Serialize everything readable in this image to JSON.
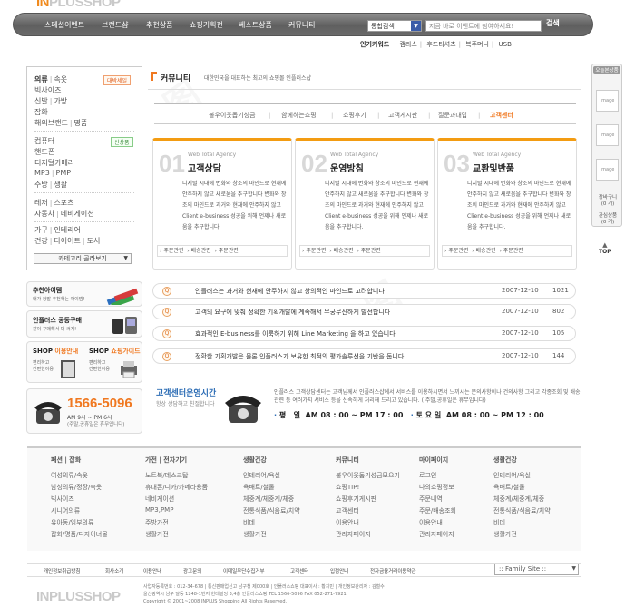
{
  "header": {
    "logo_prefix": "IN",
    "logo_rest": "PLUSSHOP",
    "nav": [
      "스페셜이벤트",
      "브랜드샵",
      "추천상품",
      "쇼핑기획전",
      "베스트상품",
      "커뮤니티"
    ],
    "search_select": "통합검색",
    "search_placeholder": "지금 바로 이벤트에 참여하세요!",
    "search_button": "검색",
    "popular_label": "인기키워드",
    "popular": [
      "캠리스",
      "후드티셔츠",
      "복주머니",
      "USB"
    ]
  },
  "sidebar": {
    "rows": [
      {
        "items": [
          "의류",
          "속옷"
        ],
        "bold": [
          0
        ]
      },
      {
        "items": [
          "빅사이즈"
        ]
      },
      {
        "items": [
          "신발",
          "가방"
        ]
      },
      {
        "items": [
          "잡화"
        ]
      },
      {
        "items": [
          "해외브랜드",
          "명품"
        ]
      },
      {
        "items": [
          "컴퓨터"
        ]
      },
      {
        "items": [
          "핸드폰"
        ]
      },
      {
        "items": [
          "디지털카메라"
        ]
      },
      {
        "items": [
          "MP3",
          "PMP"
        ]
      },
      {
        "items": [
          "주방",
          "생활"
        ]
      },
      {
        "items": [
          "레저",
          "스포츠"
        ]
      },
      {
        "items": [
          "자동차",
          "네비게이션"
        ]
      },
      {
        "items": [
          "가구",
          "인테리어"
        ]
      },
      {
        "items": [
          "건강",
          "다이어트",
          "도서"
        ]
      }
    ],
    "tag1": "대박세일",
    "tag2": "신상품",
    "more": "카테고리 골라보기",
    "banner1_title": "추천아이템",
    "banner1_sub": "내가 정말 추천하는 아이템!",
    "banner2_title": "인플러스 공동구매",
    "banner2_sub": "같이 구매해서 더 써게!",
    "banner3_left_a": "SHOP",
    "banner3_left_b": "이용안내",
    "banner3_left_sub1": "편리하고",
    "banner3_left_sub2": "간편한이용",
    "banner3_right_a": "SHOP",
    "banner3_right_b": "쇼핑가이드",
    "banner3_right_sub1": "편리하고",
    "banner3_right_sub2": "간편한이용",
    "phone": "1566-5096",
    "phone_hours": "AM 9시 ~ PM 6시",
    "phone_note": "(주말,공휴일은 휴무입니다)"
  },
  "main": {
    "title": "커뮤니티",
    "subtitle": "대한민국을 대표하는 최고의 쇼핑몰 인플러스샵",
    "tabs": [
      "불우이웃돕기성금",
      "함께하는쇼핑",
      "쇼핑후기",
      "고객게시판",
      "질문과대답",
      "고객센터"
    ],
    "panels": [
      {
        "num": "01",
        "agency": "Web Total Agency",
        "title": "고객상담",
        "body": "디지털 시대에 변화와 창조의 마인드로 현재에 안주하지 않고 새로움을 추구합니다 변화와 창조의 마인드로 과거와 현재에 안주하지 않고 Client e-business 성공을 위해 언제나 새로움을 추구합니다.",
        "links": [
          "주문관련",
          "배송관련",
          "주문관련"
        ]
      },
      {
        "num": "02",
        "agency": "Web Total Agency",
        "title": "운영방침",
        "body": "디지털 시대에 변화와 창조의 마인드로 현재에 안주하지 않고 새로움을 추구합니다 변화와 창조의 마인드로 과거와 현재에 안주하지 않고 Client e-business 성공을 위해 언제나 새로움을 추구합니다.",
        "links": [
          "주문관련",
          "배송관련",
          "주문관련"
        ]
      },
      {
        "num": "03",
        "agency": "Web Total Agency",
        "title": "교환및반품",
        "body": "디지털 시대에 변화와 창조의 마인드로 현재에 안주하지 않고 새로움을 추구합니다 변화와 창조의 마인드로 과거와 현재에 안주하지 않고 Client e-business 성공을 위해 언제나 새로움을 추구합니다.",
        "links": [
          "주문관련",
          "배송관련",
          "주문관련"
        ]
      }
    ],
    "qa": [
      {
        "q": "Q",
        "text": "인플러스는 과거와 현재에 안주하지 않고 창의적인 마인드로 고려합니다",
        "date": "2007-12-10",
        "count": "1021"
      },
      {
        "q": "Q",
        "text": "고객의 요구에 맞춰 정확한 기획개발에 계속해서 무궁무진하게 발전합니다",
        "date": "2007-12-10",
        "count": "802"
      },
      {
        "q": "Q",
        "text": "효과적인 E-business를 이룩하기 위해 Line Marketing 을 하고 있습니다",
        "date": "2007-12-10",
        "count": "105"
      },
      {
        "q": "Q",
        "text": "정확한 기획개발은 물론 인플러스가 보유한 최적의 평가솔루션을 기반을 둡니다",
        "date": "2007-12-10",
        "count": "144"
      }
    ],
    "cs_title": "고객센터운영시간",
    "cs_sub": "항상 상담하고 친절합니다",
    "cs_desc": "인플러스 고객상담센터는 고객님께서 인플러스샵에서 서비스를 이용하시면서 느끼시는 문의사항이나 건의사항 그리고 각종조회 및 배송관련 등 여러가지 서비스 등을 신속하게 처리해 드리고 있습니다. ( 주말,공휴일은 휴무입니다)",
    "cs_weekday_label": "평",
    "cs_weekday_label2": "일",
    "cs_weekday": "AM 08 : 00 ~ PM 17 : 00",
    "cs_sat_label": "토 요 일",
    "cs_sat": "AM 08 : 00 ~ PM 12 : 00"
  },
  "footer_menu": {
    "columns": [
      {
        "head": "패션 | 잡화",
        "items": [
          "여성의류/속옷",
          "남성의류/정장/속옷",
          "빅사이즈",
          "시니어의류",
          "유아동/임부의류",
          "잡화/명품/디자이너몰"
        ]
      },
      {
        "head": "가전 | 전자기기",
        "items": [
          "노트북/데스크탑",
          "휴대폰/디카/카메라용품",
          "네비게이션",
          "MP3,PMP",
          "주방가전",
          "생활가전"
        ]
      },
      {
        "head": "생활건강",
        "items": [
          "인테리어/욕실",
          "욕배트/철물",
          "체중계/체중계/체중",
          "전통식품/식음료/치약",
          "비데",
          "생활가전"
        ]
      },
      {
        "head": "커뮤니티",
        "items": [
          "불우이웃돕기성금모으기",
          "쇼핑TIP!",
          "쇼핑후기게시판",
          "고객센터",
          "이용안내",
          "관리자페이지"
        ]
      },
      {
        "head": "마이페이지",
        "items": [
          "로그인",
          "나의쇼핑정보",
          "주문내역",
          "주문/배송조회",
          "이용안내",
          "관리자페이지"
        ]
      },
      {
        "head": "생활건강",
        "items": [
          "인테리어/욕실",
          "욕배트/철물",
          "체중계/체중계/체중",
          "전통식품/식음료/치약",
          "비데",
          "생활가전"
        ]
      }
    ]
  },
  "footer": {
    "links": [
      "개인정보취급방침",
      "회사소개",
      "이용안내",
      "광고문의",
      "이메일무단수집거부",
      "고객센터",
      "입점안내",
      "전자금융거래이용약관"
    ],
    "family_site": ":: Family Site ::",
    "logo": "INPLUSSHOP",
    "address1": "사업자등록번호 : 012-34-678 | 통신판매업신고 남구청 제000호 | 인플러스쇼핑 대표이사 : 황지민 | 개인정보관리자 : 김철수",
    "address2": "울산광역시 남구 달동 1248-1번지 현대빌딩 3,4층 인플러스쇼핑 TEL 1566-5096 FAX 052-271-7921",
    "copyright": "Copyright © 2001~2008 INPLUS Shopping All Rights Reserved."
  },
  "right_sidebar": {
    "title": "오늘본상품",
    "image_label": "Image",
    "cart_a": "장바구니",
    "cart_b": "(0 개)",
    "wish_a": "관심상품",
    "wish_b": "(0 개)",
    "top": "TOP"
  }
}
